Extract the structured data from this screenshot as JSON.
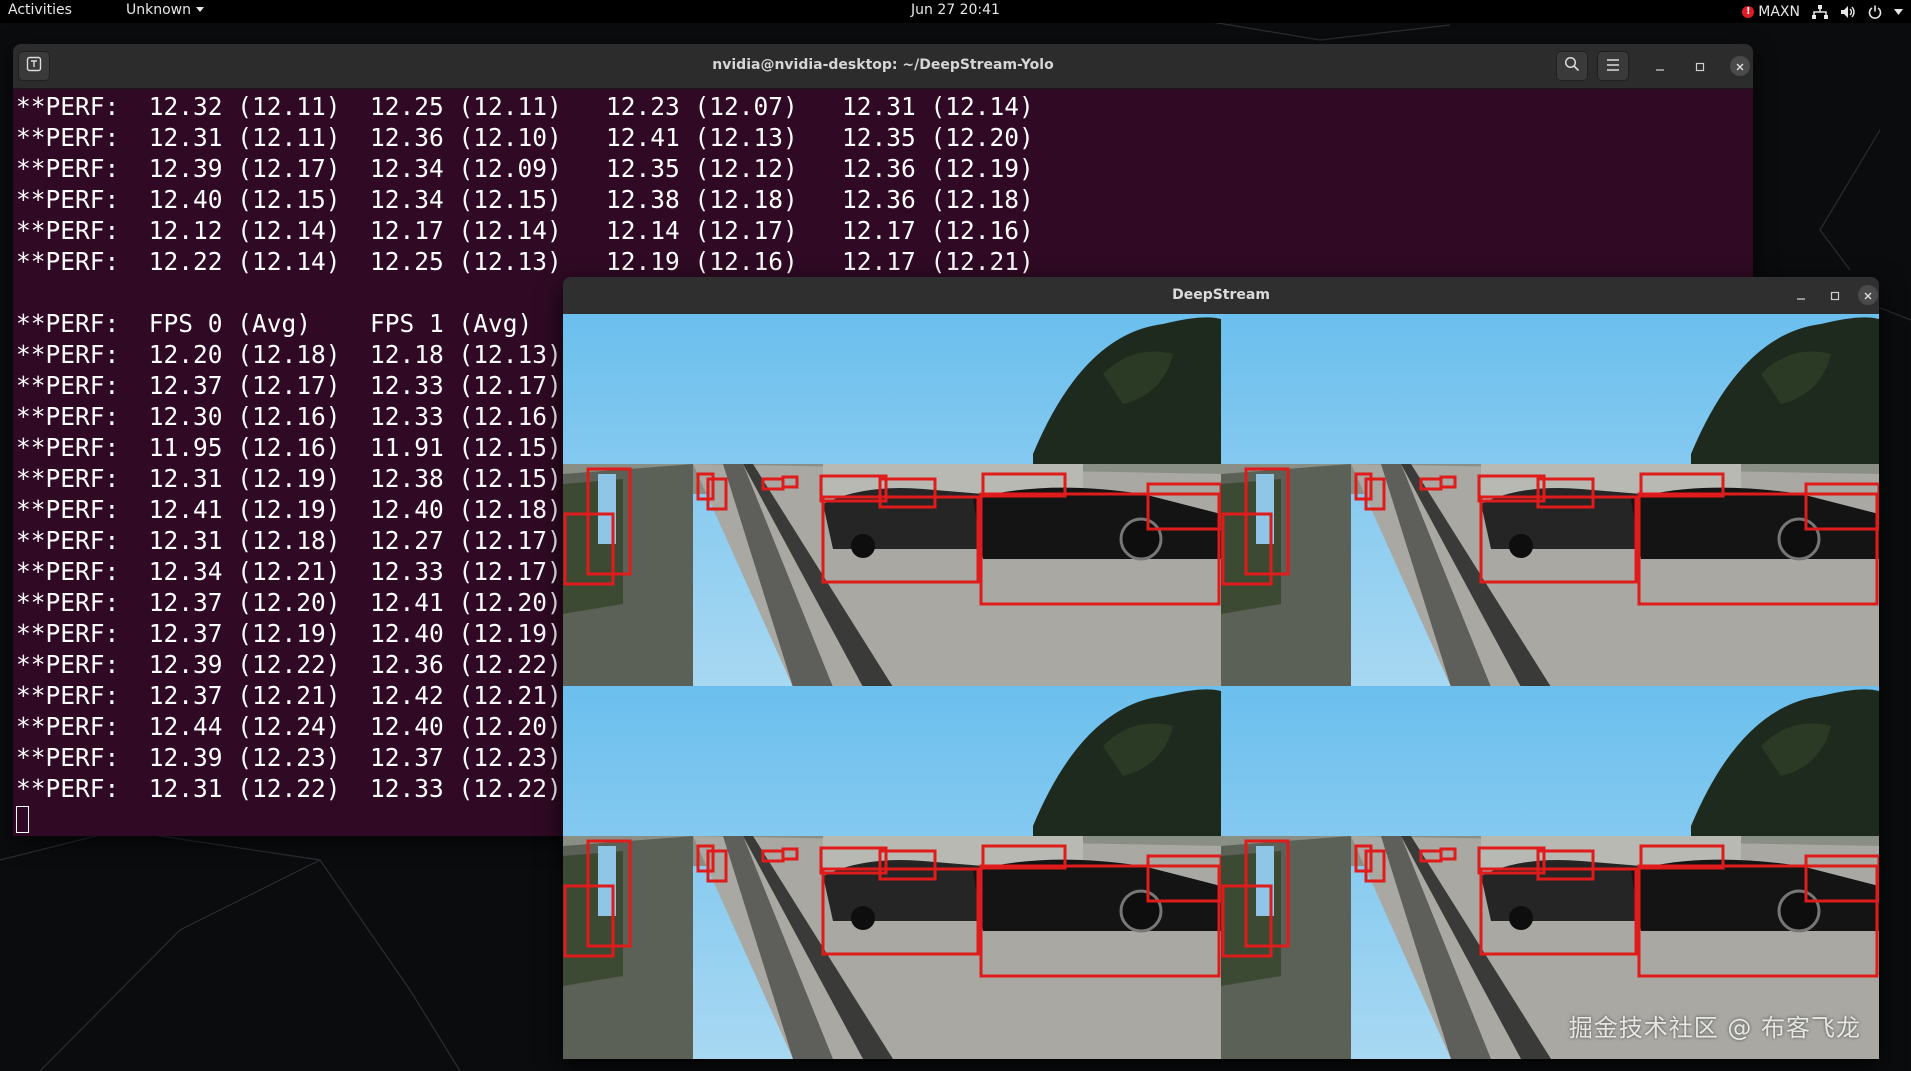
{
  "topbar": {
    "activities": "Activities",
    "app_menu": "Unknown",
    "clock": "Jun 27  20:41",
    "power_mode": "MAXN",
    "alert": "!"
  },
  "terminal": {
    "title": "nvidia@nvidia-desktop: ~/DeepStream-Yolo",
    "lines": [
      "**PERF:  12.32 (12.11)  12.25 (12.11)   12.23 (12.07)   12.31 (12.14)",
      "**PERF:  12.31 (12.11)  12.36 (12.10)   12.41 (12.13)   12.35 (12.20)",
      "**PERF:  12.39 (12.17)  12.34 (12.09)   12.35 (12.12)   12.36 (12.19)",
      "**PERF:  12.40 (12.15)  12.34 (12.15)   12.38 (12.18)   12.36 (12.18)",
      "**PERF:  12.12 (12.14)  12.17 (12.14)   12.14 (12.17)   12.17 (12.16)",
      "**PERF:  12.22 (12.14)  12.25 (12.13)   12.19 (12.16)   12.17 (12.21)",
      "",
      "**PERF:  FPS 0 (Avg)    FPS 1 (Avg)",
      "**PERF:  12.20 (12.18)  12.18 (12.13)",
      "**PERF:  12.37 (12.17)  12.33 (12.17)",
      "**PERF:  12.30 (12.16)  12.33 (12.16)",
      "**PERF:  11.95 (12.16)  11.91 (12.15)",
      "**PERF:  12.31 (12.19)  12.38 (12.15)",
      "**PERF:  12.41 (12.19)  12.40 (12.18)",
      "**PERF:  12.31 (12.18)  12.27 (12.17)",
      "**PERF:  12.34 (12.21)  12.33 (12.17)",
      "**PERF:  12.37 (12.20)  12.41 (12.20)",
      "**PERF:  12.37 (12.19)  12.40 (12.19)",
      "**PERF:  12.39 (12.22)  12.36 (12.22)",
      "**PERF:  12.37 (12.21)  12.42 (12.21)",
      "**PERF:  12.44 (12.24)  12.40 (12.20)",
      "**PERF:  12.39 (12.23)  12.37 (12.23)",
      "**PERF:  12.31 (12.22)  12.33 (12.22)"
    ]
  },
  "deepstream": {
    "title": "DeepStream",
    "tiles": [
      "stream-0",
      "stream-1",
      "stream-2",
      "stream-3"
    ],
    "watermark": "掘金技术社区 @ 布客飞龙"
  },
  "colors": {
    "terminal_bg": "#300a24",
    "headerbar_bg": "#2c2c2c",
    "bbox": "#e01b1b",
    "sky": "#7cc6ef"
  },
  "icons": {
    "new_tab": "new-tab-icon",
    "search": "search-icon",
    "menu": "hamburger-menu-icon",
    "minimize": "minimize-icon",
    "maximize": "maximize-icon",
    "close": "close-icon",
    "network": "network-icon",
    "volume": "volume-icon",
    "power": "power-icon"
  }
}
